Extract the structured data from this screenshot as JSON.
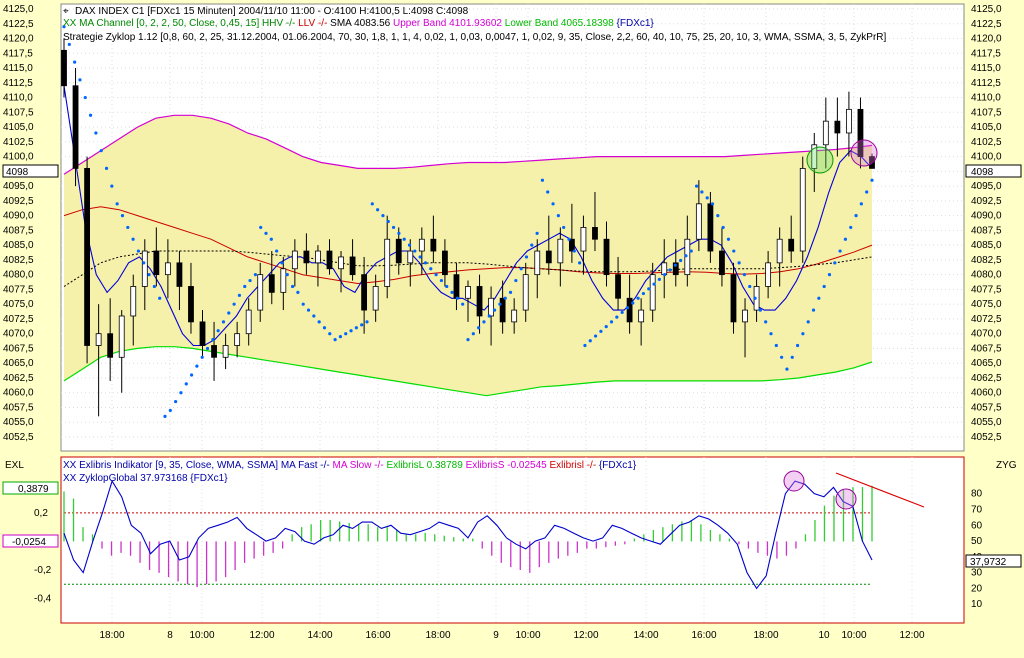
{
  "colors": {
    "background": "#ffffc8",
    "plot_background": "#ffffff",
    "channel_fill": "#f5f0aa",
    "upper_band": "#d400d4",
    "lower_band": "#00dd00",
    "sma": "#cc0000",
    "price_ma": "#0000dd",
    "sar_dots": "#0066ff",
    "candle": "#000000",
    "histo_pos": "#33cc33",
    "histo_neg": "#cc33cc",
    "ref_line_red": "#cc0000",
    "ref_line_green": "#008800",
    "zyklop": "#0000cc",
    "trend_line": "#dd0000"
  },
  "header": {
    "icon": "crosshair-icon",
    "line1": "DAX INDEX C1 [FDXc1  15 Minuten] 2004/11/10 11:00 - O:4100 H:4100,5 L:4098 C:4098",
    "line2_parts": [
      {
        "text": "XX MA Channel [0, 2, 2, 50, Close, 0,45, 15] HHV -/- ",
        "color": "#008800"
      },
      {
        "text": "LLV -/- ",
        "color": "#cc0000"
      },
      {
        "text": "SMA 4083.56 ",
        "color": "#000000"
      },
      {
        "text": "Upper Band 4101.93602 ",
        "color": "#d400d4"
      },
      {
        "text": "Lower Band 4065.18398 ",
        "color": "#00bb00"
      },
      {
        "text": "{FDXc1}",
        "color": "#0000aa"
      }
    ],
    "line3": "Strategie Zyklop 1.12 [0,8, 60, 2, 25, 31.12.2004, 01.06.2004, 70, 30, 1,8, 1, 1, 4, 0,02, 1, 0,03, 0,0047, 1, 0,02, 9, 35, Close, 2,2, 60, 40, 10, 75, 25, 20, 10, 3, WMA, SSMA, 3, 5, ZykPrR]"
  },
  "lower_header": {
    "line1_parts": [
      {
        "text": "XX Exlibris Indikator [9, 35, Close, WMA, SSMA] MA Fast -/- ",
        "color": "#0000aa"
      },
      {
        "text": "MA Slow -/- ",
        "color": "#d400d4"
      },
      {
        "text": "ExlibrisL 0.38789 ",
        "color": "#00bb00"
      },
      {
        "text": "ExlibrisS -0.02545 ",
        "color": "#d400d4"
      },
      {
        "text": "Exlibrisl -/- ",
        "color": "#cc0000"
      },
      {
        "text": "{FDXc1}",
        "color": "#0000aa"
      }
    ],
    "line2": "XX ZyklopGlobal 37.973168 {FDXc1}"
  },
  "axis_labels": {
    "left_lower": "EXL",
    "right_lower": "ZYG"
  },
  "value_boxes": {
    "price_left": "4098",
    "price_right": "4098",
    "exl_pos": "0,3879",
    "exl_neg": "-0,0254",
    "zyg": "37,9732"
  },
  "price_ticks": [
    "4125,0",
    "4122,5",
    "4120,0",
    "4117,5",
    "4115,0",
    "4112,5",
    "4110,0",
    "4107,5",
    "4105,0",
    "4102,5",
    "4100,0",
    "4097,5",
    "4095,0",
    "4092,5",
    "4090,0",
    "4087,5",
    "4085,0",
    "4082,5",
    "4080,0",
    "4077,5",
    "4075,0",
    "4072,5",
    "4070,0",
    "4067,5",
    "4065,0",
    "4062,5",
    "4060,0",
    "4057,5",
    "4055,0",
    "4052,5"
  ],
  "exl_ticks": [
    "0,2",
    "-0,2",
    "-0,4"
  ],
  "zyg_ticks": [
    "80",
    "70",
    "60",
    "50",
    "40",
    "30",
    "20",
    "10"
  ],
  "time_ticks": [
    "18:00",
    "8",
    "10:00",
    "12:00",
    "14:00",
    "16:00",
    "18:00",
    "9",
    "10:00",
    "12:00",
    "14:00",
    "16:00",
    "18:00",
    "10",
    "10:00",
    "12:00"
  ],
  "chart_data": [
    {
      "type": "line",
      "title": "",
      "y_range": [
        4050,
        4127
      ],
      "candles": [
        {
          "o": 4118,
          "h": 4120,
          "l": 4110,
          "c": 4112
        },
        {
          "o": 4112,
          "h": 4115,
          "l": 4095,
          "c": 4098
        },
        {
          "o": 4098,
          "h": 4100,
          "l": 4065,
          "c": 4068
        },
        {
          "o": 4068,
          "h": 4075,
          "l": 4056,
          "c": 4070
        },
        {
          "o": 4070,
          "h": 4076,
          "l": 4062,
          "c": 4066
        },
        {
          "o": 4066,
          "h": 4074,
          "l": 4060,
          "c": 4073
        },
        {
          "o": 4073,
          "h": 4080,
          "l": 4068,
          "c": 4078
        },
        {
          "o": 4078,
          "h": 4086,
          "l": 4074,
          "c": 4084
        },
        {
          "o": 4084,
          "h": 4088,
          "l": 4078,
          "c": 4080
        },
        {
          "o": 4080,
          "h": 4086,
          "l": 4076,
          "c": 4082
        },
        {
          "o": 4082,
          "h": 4084,
          "l": 4074,
          "c": 4078
        },
        {
          "o": 4078,
          "h": 4082,
          "l": 4070,
          "c": 4072
        },
        {
          "o": 4072,
          "h": 4074,
          "l": 4066,
          "c": 4068
        },
        {
          "o": 4068,
          "h": 4072,
          "l": 4062,
          "c": 4066
        },
        {
          "o": 4066,
          "h": 4070,
          "l": 4064,
          "c": 4068
        },
        {
          "o": 4068,
          "h": 4072,
          "l": 4066,
          "c": 4070
        },
        {
          "o": 4070,
          "h": 4076,
          "l": 4068,
          "c": 4074
        },
        {
          "o": 4074,
          "h": 4082,
          "l": 4072,
          "c": 4080
        },
        {
          "o": 4080,
          "h": 4084,
          "l": 4075,
          "c": 4077
        },
        {
          "o": 4077,
          "h": 4083,
          "l": 4074,
          "c": 4081
        },
        {
          "o": 4081,
          "h": 4086,
          "l": 4078,
          "c": 4084
        },
        {
          "o": 4084,
          "h": 4087,
          "l": 4080,
          "c": 4082
        },
        {
          "o": 4082,
          "h": 4085,
          "l": 4078,
          "c": 4084
        },
        {
          "o": 4084,
          "h": 4086,
          "l": 4080,
          "c": 4081
        },
        {
          "o": 4081,
          "h": 4084,
          "l": 4077,
          "c": 4083
        },
        {
          "o": 4083,
          "h": 4086,
          "l": 4079,
          "c": 4080
        },
        {
          "o": 4080,
          "h": 4083,
          "l": 4070,
          "c": 4074
        },
        {
          "o": 4074,
          "h": 4080,
          "l": 4072,
          "c": 4078
        },
        {
          "o": 4078,
          "h": 4090,
          "l": 4076,
          "c": 4086
        },
        {
          "o": 4086,
          "h": 4088,
          "l": 4080,
          "c": 4082
        },
        {
          "o": 4082,
          "h": 4086,
          "l": 4078,
          "c": 4084
        },
        {
          "o": 4084,
          "h": 4088,
          "l": 4080,
          "c": 4086
        },
        {
          "o": 4086,
          "h": 4090,
          "l": 4082,
          "c": 4084
        },
        {
          "o": 4084,
          "h": 4086,
          "l": 4078,
          "c": 4080
        },
        {
          "o": 4080,
          "h": 4082,
          "l": 4074,
          "c": 4076
        },
        {
          "o": 4076,
          "h": 4079,
          "l": 4072,
          "c": 4078
        },
        {
          "o": 4078,
          "h": 4080,
          "l": 4070,
          "c": 4073
        },
        {
          "o": 4073,
          "h": 4078,
          "l": 4068,
          "c": 4076
        },
        {
          "o": 4076,
          "h": 4079,
          "l": 4070,
          "c": 4072
        },
        {
          "o": 4072,
          "h": 4076,
          "l": 4070,
          "c": 4074
        },
        {
          "o": 4074,
          "h": 4082,
          "l": 4072,
          "c": 4080
        },
        {
          "o": 4080,
          "h": 4086,
          "l": 4076,
          "c": 4084
        },
        {
          "o": 4084,
          "h": 4090,
          "l": 4080,
          "c": 4082
        },
        {
          "o": 4082,
          "h": 4088,
          "l": 4078,
          "c": 4086
        },
        {
          "o": 4086,
          "h": 4092,
          "l": 4082,
          "c": 4084
        },
        {
          "o": 4084,
          "h": 4090,
          "l": 4080,
          "c": 4088
        },
        {
          "o": 4088,
          "h": 4094,
          "l": 4084,
          "c": 4086
        },
        {
          "o": 4086,
          "h": 4089,
          "l": 4078,
          "c": 4080
        },
        {
          "o": 4080,
          "h": 4083,
          "l": 4074,
          "c": 4076
        },
        {
          "o": 4076,
          "h": 4080,
          "l": 4070,
          "c": 4072
        },
        {
          "o": 4072,
          "h": 4076,
          "l": 4068,
          "c": 4074
        },
        {
          "o": 4074,
          "h": 4082,
          "l": 4072,
          "c": 4080
        },
        {
          "o": 4080,
          "h": 4086,
          "l": 4076,
          "c": 4082
        },
        {
          "o": 4082,
          "h": 4086,
          "l": 4078,
          "c": 4080
        },
        {
          "o": 4080,
          "h": 4090,
          "l": 4078,
          "c": 4086
        },
        {
          "o": 4086,
          "h": 4096,
          "l": 4084,
          "c": 4092
        },
        {
          "o": 4092,
          "h": 4094,
          "l": 4082,
          "c": 4084
        },
        {
          "o": 4084,
          "h": 4088,
          "l": 4078,
          "c": 4080
        },
        {
          "o": 4080,
          "h": 4082,
          "l": 4070,
          "c": 4072
        },
        {
          "o": 4072,
          "h": 4076,
          "l": 4066,
          "c": 4074
        },
        {
          "o": 4074,
          "h": 4080,
          "l": 4072,
          "c": 4078
        },
        {
          "o": 4078,
          "h": 4084,
          "l": 4076,
          "c": 4082
        },
        {
          "o": 4082,
          "h": 4088,
          "l": 4078,
          "c": 4086
        },
        {
          "o": 4086,
          "h": 4090,
          "l": 4082,
          "c": 4084
        },
        {
          "o": 4084,
          "h": 4100,
          "l": 4082,
          "c": 4098
        },
        {
          "o": 4098,
          "h": 4104,
          "l": 4094,
          "c": 4102
        },
        {
          "o": 4102,
          "h": 4110,
          "l": 4098,
          "c": 4106
        },
        {
          "o": 4106,
          "h": 4110,
          "l": 4100,
          "c": 4104
        },
        {
          "o": 4104,
          "h": 4111,
          "l": 4100,
          "c": 4108
        },
        {
          "o": 4108,
          "h": 4110,
          "l": 4098,
          "c": 4100
        },
        {
          "o": 4100,
          "h": 4100.5,
          "l": 4098,
          "c": 4098
        }
      ],
      "upper_band": [
        4097,
        4099,
        4101,
        4103,
        4105,
        4106.5,
        4107,
        4107,
        4106.5,
        4105.5,
        4104,
        4103,
        4101.5,
        4100,
        4099,
        4098.5,
        4098,
        4098,
        4098,
        4098.2,
        4098.5,
        4098.8,
        4099,
        4099,
        4099,
        4099.2,
        4099.4,
        4099.6,
        4099.8,
        4100,
        4100,
        4100,
        4100,
        4100,
        4100,
        4100,
        4100,
        4100.2,
        4100.4,
        4100.6,
        4100.8,
        4101,
        4101.2,
        4101.5,
        4101.9
      ],
      "lower_band": [
        4062,
        4064,
        4066,
        4067,
        4067.5,
        4067.8,
        4067.8,
        4067.5,
        4067,
        4066.5,
        4066,
        4065.5,
        4065,
        4064.5,
        4064,
        4063.5,
        4063,
        4062.5,
        4062,
        4061.5,
        4061,
        4060.5,
        4060,
        4059.5,
        4060,
        4060.5,
        4061,
        4061.2,
        4061.5,
        4061.8,
        4062,
        4062,
        4062,
        4062,
        4062,
        4062,
        4062,
        4062,
        4062,
        4062.2,
        4062.5,
        4063,
        4063.5,
        4064.2,
        4065.2
      ],
      "sma": [
        4090,
        4091,
        4091.5,
        4091,
        4090,
        4089,
        4088,
        4087,
        4086,
        4084.5,
        4083,
        4082,
        4081,
        4080,
        4079.5,
        4079,
        4078.5,
        4078.8,
        4079.2,
        4079.8,
        4080.2,
        4080.5,
        4080.8,
        4081,
        4081.2,
        4081.2,
        4081,
        4080.8,
        4080.5,
        4080.3,
        4080.2,
        4080.2,
        4080.3,
        4080.4,
        4080.5,
        4080.4,
        4080.2,
        4080.1,
        4080.2,
        4080.5,
        4081,
        4081.8,
        4082.8,
        4083.8,
        4085
      ],
      "sma_dotted": [
        4078,
        4080,
        4082,
        4083,
        4083.5,
        4084,
        4084,
        4084,
        4084,
        4084,
        4083.8,
        4083.5,
        4083.2,
        4083,
        4082.5,
        4082,
        4081.5,
        4081.5,
        4081.6,
        4081.8,
        4082,
        4082,
        4082,
        4081.8,
        4081.5,
        4081.2,
        4081,
        4080.8,
        4080.6,
        4080.5,
        4080.5,
        4080.5,
        4080.6,
        4080.8,
        4081,
        4081,
        4081,
        4081,
        4081,
        4081.2,
        4081.4,
        4081.7,
        4082,
        4082.5,
        4083
      ],
      "ma_blue": [
        4112,
        4100,
        4088,
        4080,
        4077,
        4079,
        4082,
        4083,
        4081,
        4078,
        4074,
        4070,
        4068,
        4068,
        4069,
        4071,
        4073,
        4076,
        4078,
        4080,
        4082,
        4083,
        4083,
        4082,
        4082,
        4081,
        4078,
        4077,
        4080,
        4082,
        4083,
        4084,
        4084,
        4082,
        4079,
        4077,
        4076,
        4076,
        4075,
        4074,
        4076,
        4079,
        4082,
        4084,
        4085,
        4086,
        4087,
        4086,
        4083,
        4079,
        4076,
        4074,
        4074,
        4076,
        4079,
        4081,
        4083,
        4084,
        4085,
        4086,
        4086,
        4085,
        4082,
        4078,
        4075,
        4074,
        4074,
        4076,
        4079,
        4083,
        4088,
        4094,
        4099,
        4101,
        4100,
        4098
      ],
      "sar": [
        4122,
        4119,
        4116,
        4113,
        4110,
        4107,
        4104,
        4101,
        4098,
        4095,
        4092,
        4090,
        4088,
        4086,
        4084,
        4082,
        4080,
        4078,
        4076,
        4056,
        4057,
        4058.5,
        4060,
        4061.5,
        4063,
        4064.5,
        4066,
        4067.5,
        4069,
        4070.5,
        4072,
        4073.5,
        4075,
        4076.5,
        4078,
        4079,
        4080,
        4088,
        4087,
        4086,
        4084,
        4082,
        4080,
        4078,
        4077,
        4075,
        4074,
        4073,
        4072,
        4071,
        4070,
        4069,
        4069.5,
        4070,
        4070.5,
        4071,
        4071.5,
        4072,
        4092,
        4091,
        4090,
        4089,
        4088,
        4087,
        4086,
        4085,
        4084,
        4083,
        4082,
        4081,
        4080,
        4079,
        4078,
        4077,
        4076,
        4075,
        4069,
        4070,
        4071,
        4072,
        4073,
        4074,
        4075,
        4076,
        4077,
        4079,
        4081,
        4083,
        4085,
        4087,
        4096,
        4094,
        4092,
        4090,
        4088,
        4086,
        4084,
        4082,
        4068,
        4068.8,
        4069.6,
        4070.4,
        4071.2,
        4072,
        4072.8,
        4073.6,
        4074.4,
        4075.2,
        4076,
        4076.8,
        4077.6,
        4078.4,
        4079.2,
        4080,
        4080.8,
        4081.6,
        4082.4,
        4083.2,
        4084,
        4095,
        4094,
        4093,
        4092,
        4090,
        4088,
        4086,
        4084,
        4082,
        4080,
        4078,
        4076,
        4074,
        4072,
        4070,
        4068,
        4066,
        4064,
        4066,
        4068,
        4070,
        4072,
        4074,
        4076,
        4078,
        4080,
        4082,
        4084,
        4086,
        4088,
        4090,
        4092,
        4094,
        4096
      ]
    },
    {
      "type": "bar",
      "title": "",
      "y_range": [
        -0.55,
        0.5
      ],
      "levels": [
        0.2,
        -0.3
      ],
      "histogram": [
        0.35,
        0.3,
        0.1,
        0.05,
        -0.05,
        -0.1,
        -0.08,
        -0.1,
        -0.15,
        -0.2,
        -0.22,
        -0.25,
        -0.28,
        -0.3,
        -0.32,
        -0.3,
        -0.28,
        -0.25,
        -0.2,
        -0.15,
        -0.12,
        -0.1,
        -0.08,
        -0.05,
        0.05,
        0.1,
        0.12,
        0.15,
        0.15,
        0.14,
        0.13,
        0.12,
        0.12,
        0.1,
        0.1,
        0.08,
        0.05,
        0.05,
        0.06,
        0.05,
        0.04,
        0.03,
        0.02,
        0.02,
        -0.05,
        -0.1,
        -0.15,
        -0.18,
        -0.2,
        -0.22,
        -0.18,
        -0.15,
        -0.12,
        -0.1,
        -0.08,
        -0.05,
        -0.05,
        -0.04,
        -0.03,
        -0.02,
        0.02,
        0.05,
        0.08,
        0.1,
        0.12,
        0.14,
        0.15,
        0.12,
        0.08,
        0.05,
        0.02,
        -0.02,
        -0.05,
        -0.08,
        -0.1,
        -0.12,
        -0.1,
        -0.05,
        0.05,
        0.15,
        0.25,
        0.32,
        0.36,
        0.38,
        0.38,
        0.39
      ]
    },
    {
      "type": "line",
      "title": "",
      "y_range": [
        0,
        95
      ],
      "zyklop": [
        55,
        38,
        30,
        50,
        68,
        88,
        78,
        60,
        55,
        42,
        48,
        50,
        38,
        40,
        52,
        58,
        60,
        62,
        65,
        58,
        54,
        50,
        52,
        58,
        56,
        50,
        48,
        52,
        54,
        60,
        58,
        62,
        62,
        58,
        60,
        55,
        54,
        56,
        58,
        62,
        60,
        58,
        52,
        62,
        66,
        60,
        52,
        48,
        45,
        50,
        52,
        60,
        58,
        55,
        52,
        50,
        52,
        60,
        58,
        55,
        52,
        50,
        48,
        54,
        60,
        62,
        66,
        64,
        60,
        55,
        48,
        30,
        20,
        28,
        55,
        80,
        88,
        86,
        80,
        78,
        84,
        75,
        72,
        50,
        38
      ]
    },
    {
      "type": "line",
      "title": "",
      "x_labels": [
        "18:00",
        "8",
        "10:00",
        "12:00",
        "14:00",
        "16:00",
        "18:00",
        "9",
        "10:00",
        "12:00",
        "14:00",
        "16:00",
        "18:00",
        "10",
        "10:00",
        "12:00"
      ]
    }
  ]
}
